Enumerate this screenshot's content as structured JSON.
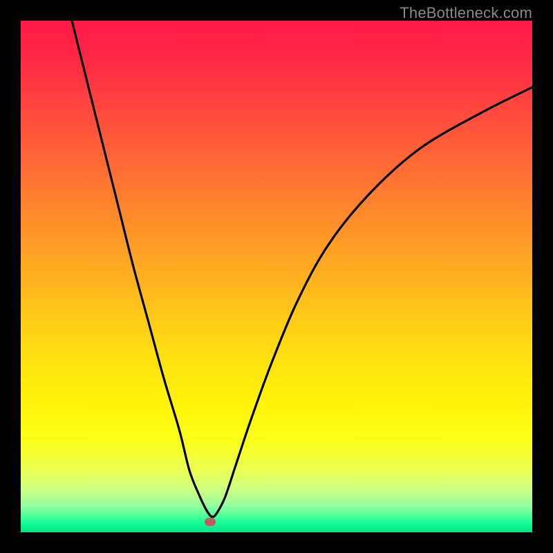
{
  "watermark": "TheBottleneck.com",
  "colors": {
    "frame": "#000000",
    "gradient_top": "#ff1a47",
    "gradient_bottom": "#00e688",
    "curve": "#000000",
    "marker": "#bb615c"
  },
  "chart_data": {
    "type": "line",
    "title": "",
    "xlabel": "",
    "ylabel": "",
    "xlim": [
      0,
      100
    ],
    "ylim": [
      0,
      100
    ],
    "grid": false,
    "legend": false,
    "marker": {
      "x": 37,
      "y": 2
    },
    "series": [
      {
        "name": "curve",
        "x": [
          10,
          13,
          16,
          19,
          22,
          25,
          28,
          31,
          33,
          35,
          36.5,
          37.5,
          38.5,
          40,
          42,
          45,
          49,
          54,
          60,
          68,
          78,
          90,
          100
        ],
        "values": [
          100,
          88,
          76,
          64,
          52,
          41,
          30,
          20,
          12,
          7,
          4,
          3,
          4,
          7,
          13,
          22,
          33,
          45,
          56,
          66,
          75,
          82,
          87
        ]
      }
    ]
  }
}
